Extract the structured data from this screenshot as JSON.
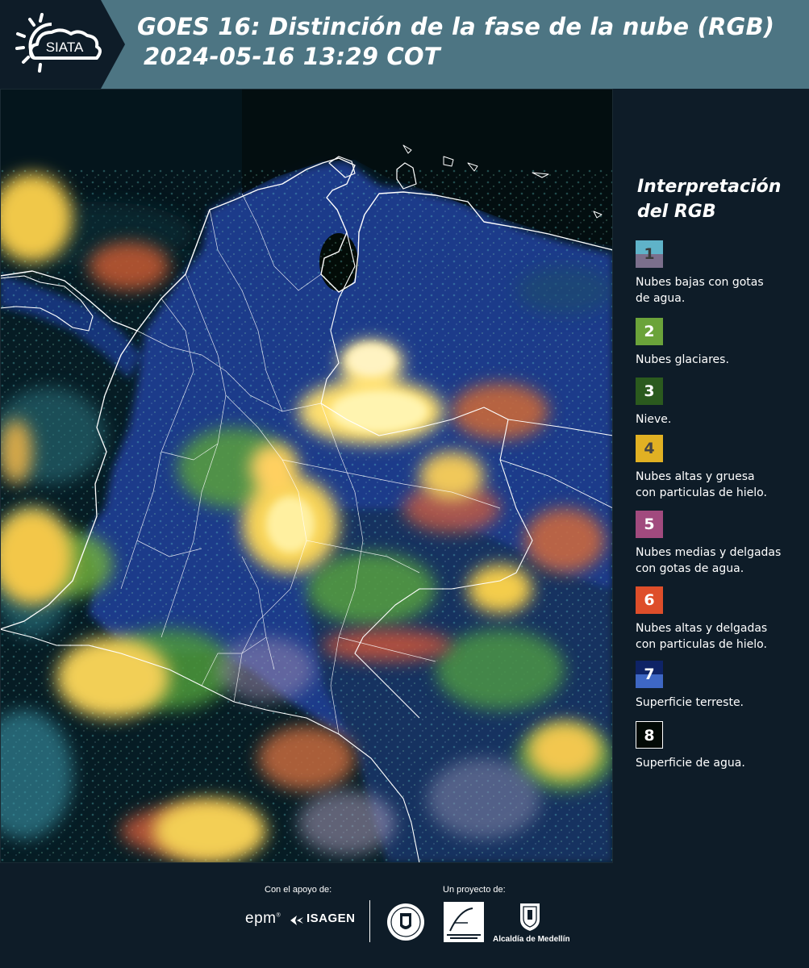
{
  "header": {
    "logo_text": "SIATA",
    "title_line1": "GOES 16: Distinción de la fase de la nube (RGB)",
    "title_line2": "2024-05-16 13:29 COT"
  },
  "legend": {
    "title_line1": "Interpretación",
    "title_line2": "del RGB",
    "items": [
      {
        "number": "1",
        "label_line1": "Nubes bajas con gotas",
        "label_line2": "de agua.",
        "color_top": "#5fb3c9",
        "color_bottom": "#7b6f8c",
        "number_color": "#3a3a3a"
      },
      {
        "number": "2",
        "label_line1": "Nubes glaciares.",
        "label_line2": "",
        "color_top": "#6ba33a",
        "color_bottom": "#6ba33a",
        "number_color": "#ffffff"
      },
      {
        "number": "3",
        "label_line1": "Nieve.",
        "label_line2": "",
        "color_top": "#2b5a1e",
        "color_bottom": "#2b5a1e",
        "number_color": "#ffffff"
      },
      {
        "number": "4",
        "label_line1": "Nubes altas y gruesa",
        "label_line2": "con particulas de hielo.",
        "color_top": "#e1b123",
        "color_bottom": "#e1b123",
        "number_color": "#444444"
      },
      {
        "number": "5",
        "label_line1": "Nubes medias y delgadas",
        "label_line2": "con gotas de agua.",
        "color_top": "#a14a7e",
        "color_bottom": "#a14a7e",
        "number_color": "#ffffff"
      },
      {
        "number": "6",
        "label_line1": "Nubes altas y delgadas",
        "label_line2": "con particulas de hielo.",
        "color_top": "#de4e2a",
        "color_bottom": "#de4e2a",
        "number_color": "#ffffff"
      },
      {
        "number": "7",
        "label_line1": "Superficie terreste.",
        "label_line2": "",
        "color_top": "#0e2366",
        "color_bottom": "#3e67c4",
        "number_color": "#ffffff"
      },
      {
        "number": "8",
        "label_line1": "Superficie de agua.",
        "label_line2": "",
        "color_top": "#020a06",
        "color_bottom": "#020a06",
        "number_color": "#ffffff"
      }
    ]
  },
  "footer": {
    "support_label": "Con el apoyo de:",
    "project_label": "Un proyecto de:",
    "epm_text": "epm",
    "epm_mark": "®",
    "isagen_text": "ISAGEN",
    "alcaldia_text": "Alcaldía de Medellín"
  },
  "colors": {
    "header_bg": "#4d7583",
    "logo_bg": "#0e1c28",
    "panel_bg": "#0e1c28",
    "map_border": "#ffffff"
  }
}
